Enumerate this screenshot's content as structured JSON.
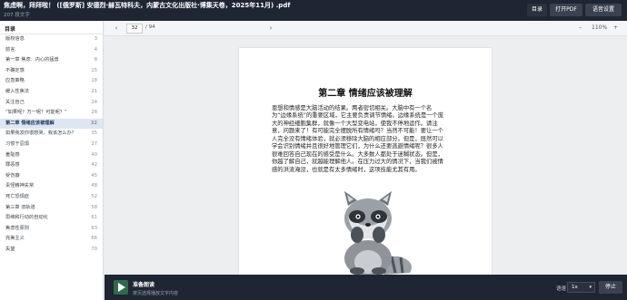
{
  "header": {
    "title": "焦虑啊，拜拜啦！ ([俄罗斯] 安德烈·赫瓦特科夫，内蒙古文化出版社·博集天卷，2025年11月) .pdf",
    "subtitle": "207 段文字",
    "toc_button": "目录",
    "open_pdf_button": "打开PDF",
    "voice_settings_button": "语音设置"
  },
  "sidebar": {
    "heading": "目录",
    "items": [
      {
        "label": "版权信息",
        "page": "3",
        "active": false
      },
      {
        "label": "前言",
        "page": "4",
        "active": false
      },
      {
        "label": "第一章 焦虑：内心的猛兽",
        "page": "8",
        "active": false
      },
      {
        "label": "不确定感",
        "page": "15",
        "active": false
      },
      {
        "label": "应急策略",
        "page": "18",
        "active": false
      },
      {
        "label": "缓入性焦法",
        "page": "21",
        "active": false
      },
      {
        "label": "关注自己",
        "page": "24",
        "active": false
      },
      {
        "label": "“如果呢？万一呢？可能呢？”",
        "page": "28",
        "active": false
      },
      {
        "label": "第二章 情绪应该被理解",
        "page": "32",
        "active": true
      },
      {
        "label": "如果我发你很想哭，我该怎么办？",
        "page": "35",
        "active": false
      },
      {
        "label": "习惯于忍惧",
        "page": "37",
        "active": false
      },
      {
        "label": "羞耻感",
        "page": "40",
        "active": false
      },
      {
        "label": "罪恶感",
        "page": "42",
        "active": false
      },
      {
        "label": "受伤癖",
        "page": "45",
        "active": false
      },
      {
        "label": "责怪精神失常",
        "page": "48",
        "active": false
      },
      {
        "label": "死亡恐惧症",
        "page": "52",
        "active": false
      },
      {
        "label": "第三章 旧轨道",
        "page": "58",
        "active": false
      },
      {
        "label": "思维和行动的自动化",
        "page": "61",
        "active": false
      },
      {
        "label": "焦虑性原则",
        "page": "63",
        "active": false
      },
      {
        "label": "完美主义",
        "page": "66",
        "active": false
      },
      {
        "label": "失望",
        "page": "70",
        "active": false
      }
    ]
  },
  "toolbar": {
    "current_page": "32",
    "total_pages": "/ 94",
    "zoom_level": "110%",
    "zoom_out": "–",
    "zoom_in": "+"
  },
  "page": {
    "chapter_title": "第二章 情绪应该被理解",
    "lines": [
      "恩想和情感是大脑活动的结果。两者密切相关。大脑中有一个名",
      "为“边缘系统”的重要区域，它主要负责调节情绪。边缘系统是一个庞",
      "大的神经细胞集群，就像一个大型变电站，使我不停地运作。请注",
      "意，问题来了！有可能完全摆脱所有情绪吗？当然不可能！要让一个",
      "人完全没有情绪体验，就必须移除大脑的相应部分。但是，既然可以",
      "学会识别情绪并且很好地管理它们，为什么还要逃避情绪呢？很多人",
      "很难回答自己现在的感受是什么。大多数人都处于迷糊状态。但是，",
      "你越了解自己，就越能理解他人。在压力过大的情况下，当我们被情",
      "感的洪流淹没，也就是有太多情绪时，这项技能尤其有用。"
    ]
  },
  "bottom": {
    "title": "准备朗读",
    "subtitle": "按页选择播放文字内容",
    "speed_label": "语速",
    "speed_value": "1x",
    "stop_button": "停止"
  },
  "colors": {
    "header_bg": "#1f2633",
    "active_toc_bg": "#dde6f2",
    "play_button": "#2f6b4a"
  }
}
